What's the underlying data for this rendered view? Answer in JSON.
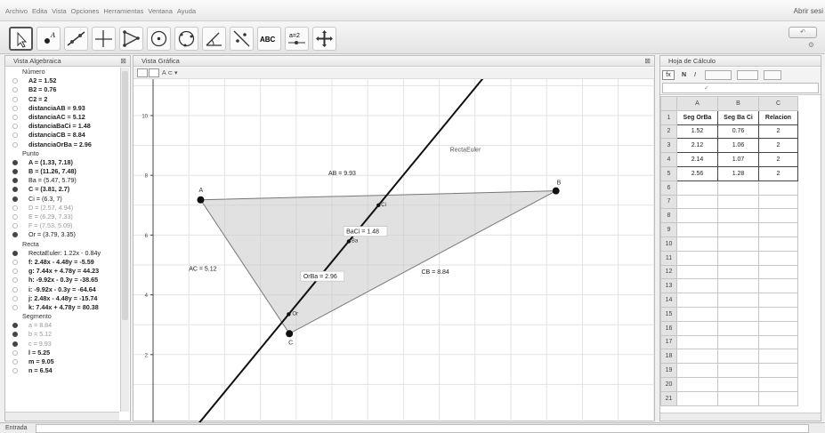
{
  "menubar": {
    "items": [
      "Archivo",
      "Edita",
      "Vista",
      "Opciones",
      "Herramientas",
      "Ventana",
      "Ayuda"
    ],
    "login": "Abrir sesi"
  },
  "toolbar": {
    "tools": [
      "move-tool",
      "point-tool",
      "line-tool",
      "perpendicular-tool",
      "polygon-tool",
      "circle-tool",
      "conic-tool",
      "angle-tool",
      "reflect-tool",
      "text-tool",
      "slider-tool",
      "move-view-tool"
    ],
    "text_tool_label": "ABC",
    "slider_tool_label": "a=2"
  },
  "algebra": {
    "title": "Vista Algebraica",
    "rows": [
      {
        "kind": "cat",
        "text": "Número"
      },
      {
        "kind": "item",
        "text": "A2 = 1.52",
        "dot": false,
        "bold": true
      },
      {
        "kind": "item",
        "text": "B2 = 0.76",
        "dot": false,
        "bold": true
      },
      {
        "kind": "item",
        "text": "C2 = 2",
        "dot": false,
        "bold": true
      },
      {
        "kind": "item",
        "text": "distanciaAB = 9.93",
        "dot": false,
        "bold": true
      },
      {
        "kind": "item",
        "text": "distanciaAC = 5.12",
        "dot": false,
        "bold": true
      },
      {
        "kind": "item",
        "text": "distanciaBaCi = 1.48",
        "dot": false,
        "bold": true
      },
      {
        "kind": "item",
        "text": "distanciaCB = 8.84",
        "dot": false,
        "bold": true
      },
      {
        "kind": "item",
        "text": "distanciaOrBa = 2.96",
        "dot": false,
        "bold": true
      },
      {
        "kind": "cat",
        "text": "Punto"
      },
      {
        "kind": "item",
        "text": "A = (1.33, 7.18)",
        "dot": true,
        "bold": true
      },
      {
        "kind": "item",
        "text": "B = (11.26, 7.48)",
        "dot": true,
        "bold": true
      },
      {
        "kind": "item",
        "text": "Ba = (5.47, 5.79)",
        "dot": true,
        "bold": false
      },
      {
        "kind": "item",
        "text": "C = (3.81, 2.7)",
        "dot": true,
        "bold": true
      },
      {
        "kind": "item",
        "text": "Ci = (6.3, 7)",
        "dot": true,
        "bold": false
      },
      {
        "kind": "item",
        "text": "D = (2.57, 4.94)",
        "dot": false,
        "bold": false,
        "grey": true
      },
      {
        "kind": "item",
        "text": "E = (6.29, 7.33)",
        "dot": false,
        "bold": false,
        "grey": true
      },
      {
        "kind": "item",
        "text": "F = (7.53, 5.09)",
        "dot": false,
        "bold": false,
        "grey": true
      },
      {
        "kind": "item",
        "text": "Or = (3.79, 3.35)",
        "dot": true,
        "bold": false
      },
      {
        "kind": "cat",
        "text": "Recta"
      },
      {
        "kind": "item",
        "text": "RectaEuler: 1.22x - 0.84y",
        "dot": true,
        "bold": false
      },
      {
        "kind": "item",
        "text": "f: 2.48x - 4.48y = -5.59",
        "dot": false,
        "bold": true
      },
      {
        "kind": "item",
        "text": "g: 7.44x + 4.78y = 44.23",
        "dot": false,
        "bold": true
      },
      {
        "kind": "item",
        "text": "h: -9.92x - 0.3y = -38.65",
        "dot": false,
        "bold": true
      },
      {
        "kind": "item",
        "text": "i: -9.92x - 0.3y = -64.64",
        "dot": false,
        "bold": true
      },
      {
        "kind": "item",
        "text": "j: 2.48x - 4.48y = -15.74",
        "dot": false,
        "bold": true
      },
      {
        "kind": "item",
        "text": "k: 7.44x + 4.78y = 80.38",
        "dot": false,
        "bold": true
      },
      {
        "kind": "cat",
        "text": "Segmento"
      },
      {
        "kind": "item",
        "text": "a = 8.84",
        "dot": true,
        "bold": false,
        "grey": true
      },
      {
        "kind": "item",
        "text": "b = 5.12",
        "dot": true,
        "bold": false,
        "grey": true
      },
      {
        "kind": "item",
        "text": "c = 9.93",
        "dot": true,
        "bold": false,
        "grey": true
      },
      {
        "kind": "item",
        "text": "l = 5.25",
        "dot": false,
        "bold": true
      },
      {
        "kind": "item",
        "text": "m = 9.05",
        "dot": false,
        "bold": true
      },
      {
        "kind": "item",
        "text": "n = 6.54",
        "dot": false,
        "bold": true
      }
    ]
  },
  "graphics": {
    "title": "Vista Gráfica",
    "y_ticks": [
      "2",
      "4",
      "6",
      "8",
      "10"
    ],
    "euler_label": "RectaEuler",
    "points": [
      {
        "name": "A",
        "x": 1.33,
        "y": 7.18,
        "big": true
      },
      {
        "name": "B",
        "x": 11.26,
        "y": 7.48,
        "big": true
      },
      {
        "name": "C",
        "x": 3.81,
        "y": 2.7,
        "big": true
      },
      {
        "name": "Ba",
        "x": 5.47,
        "y": 5.79,
        "big": false
      },
      {
        "name": "Ci",
        "x": 6.3,
        "y": 7,
        "big": false
      },
      {
        "name": "Or",
        "x": 3.79,
        "y": 3.35,
        "big": false
      }
    ],
    "segment_labels": {
      "AB": "AB = 9.93",
      "AC": "AC = 5.12",
      "CB": "CB = 8.84",
      "BaCi": "BaCi = 1.48",
      "OrBa": "OrBa = 2.96"
    }
  },
  "sheet": {
    "title": "Hoja de Cálculo",
    "toolbar": {
      "fx": "fx",
      "bold": "N",
      "italic": "I"
    },
    "columns": [
      "A",
      "B",
      "C"
    ],
    "row_count": 21,
    "headers": [
      "Seg OrBa",
      "Seg Ba Ci",
      "Relacion"
    ],
    "rows": [
      [
        "1.52",
        "0.76",
        "2"
      ],
      [
        "2.12",
        "1.06",
        "2"
      ],
      [
        "2.14",
        "1.07",
        "2"
      ],
      [
        "2.56",
        "1.28",
        "2"
      ]
    ]
  },
  "input": {
    "label": "Entrada"
  },
  "colors": {
    "polygon": "#c8c8c8",
    "euler": "#111111",
    "point": "#111111"
  }
}
